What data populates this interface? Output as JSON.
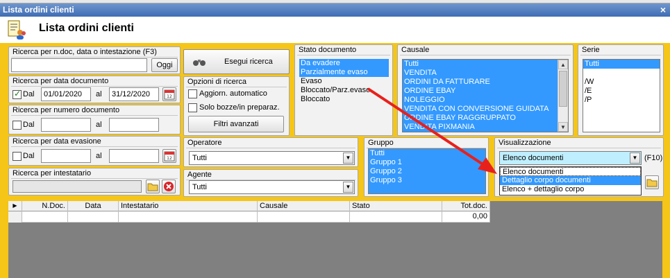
{
  "window": {
    "title": "Lista ordini clienti",
    "close_glyph": "×"
  },
  "header": {
    "title": "Lista ordini clienti",
    "icon": "document-list-users-icon"
  },
  "search_text": {
    "title": "Ricerca per n.doc, data o intestazione (F3)",
    "value": "",
    "button": "Oggi"
  },
  "search_date": {
    "title": "Ricerca per data documento",
    "checkbox_label": "Dal",
    "checked": true,
    "from": "01/01/2020",
    "to_label": "al",
    "to": "31/12/2020"
  },
  "search_number": {
    "title": "Ricerca per numero documento",
    "checkbox_label": "Dal",
    "from": "",
    "to_label": "al",
    "to": ""
  },
  "search_due": {
    "title": "Ricerca per data evasione",
    "checkbox_label": "Dal",
    "from": "",
    "to_label": "al",
    "to": ""
  },
  "search_holder": {
    "title": "Ricerca per intestatario",
    "value": ""
  },
  "search_button": {
    "label": "Esegui ricerca"
  },
  "options": {
    "title": "Opzioni di ricerca",
    "auto_update": "Aggiorn. automatico",
    "drafts_only": "Solo bozze/in preparaz.",
    "advanced": "Filtri avanzati"
  },
  "operator": {
    "title": "Operatore",
    "value": "Tutti"
  },
  "agent": {
    "title": "Agente",
    "value": "Tutti"
  },
  "status": {
    "title": "Stato documento",
    "items": [
      {
        "label": "Da evadere",
        "selected": true
      },
      {
        "label": "Parzialmente evaso",
        "selected": true
      },
      {
        "label": "Evaso",
        "selected": false
      },
      {
        "label": "Bloccato/Parz.evaso",
        "selected": false
      },
      {
        "label": "Bloccato",
        "selected": false
      }
    ]
  },
  "causale": {
    "title": "Causale",
    "items": [
      "Tutti",
      "VENDITA",
      "ORDINI DA FATTURARE",
      "ORDINE EBAY",
      "NOLEGGIO",
      "VENDITA CON CONVERSIONE GUIDATA",
      "ORDINE EBAY RAGGRUPPATO",
      "VENDITA PIXMANIA"
    ]
  },
  "serie": {
    "title": "Serie",
    "items": [
      "Tutti",
      "",
      "/W",
      "/E",
      "/P"
    ]
  },
  "gruppo": {
    "title": "Gruppo",
    "items": [
      "Tutti",
      "Gruppo 1",
      "Gruppo 2",
      "Gruppo 3"
    ]
  },
  "visualizzazione": {
    "title": "Visualizzazione",
    "selected": "Elenco documenti",
    "shortcut": "(F10)",
    "options": [
      "Elenco documenti",
      "Dettaglio corpo documenti",
      "Elenco + dettaglio corpo"
    ],
    "highlighted_index": 1
  },
  "table": {
    "columns": [
      "N.Doc.",
      "Data",
      "Intestatario",
      "Causale",
      "Stato",
      "Tot.doc."
    ],
    "total": "0,00"
  },
  "colors": {
    "accent": "#f5c518",
    "selection": "#3399ff",
    "title_bar": "#3f6db4",
    "annotation_arrow": "#e8201c"
  }
}
